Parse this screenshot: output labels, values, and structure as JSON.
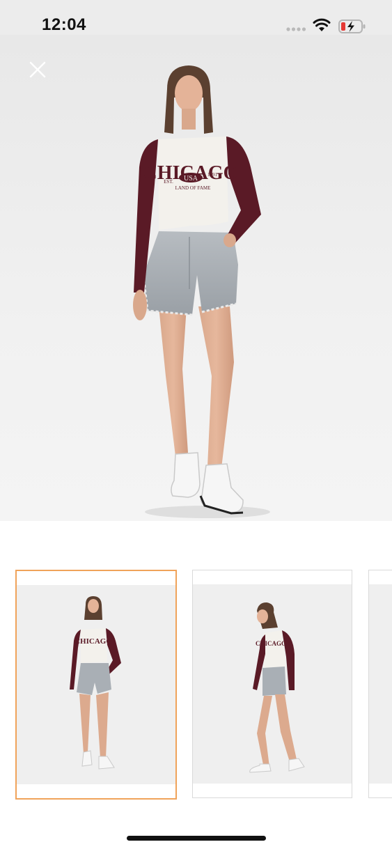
{
  "status_bar": {
    "time": "12:04",
    "icons": [
      "cellular-signal-icon",
      "wifi-icon",
      "battery-charging-icon"
    ],
    "battery_color": "#e53935"
  },
  "viewer": {
    "close_icon": "close-icon",
    "main_image": {
      "description_icon": "product-photo",
      "shirt_text": {
        "line1": "CHICAGO",
        "est": "EST.",
        "badge": "USA",
        "year": "1991",
        "line3": "LAND OF FAME"
      }
    },
    "thumbnails": [
      {
        "id": "front",
        "selected": true
      },
      {
        "id": "side",
        "selected": false
      },
      {
        "id": "partial",
        "selected": false
      }
    ],
    "selected_border_color": "#f0a35a",
    "shirt_sleeve_color": "#5a1a26"
  }
}
